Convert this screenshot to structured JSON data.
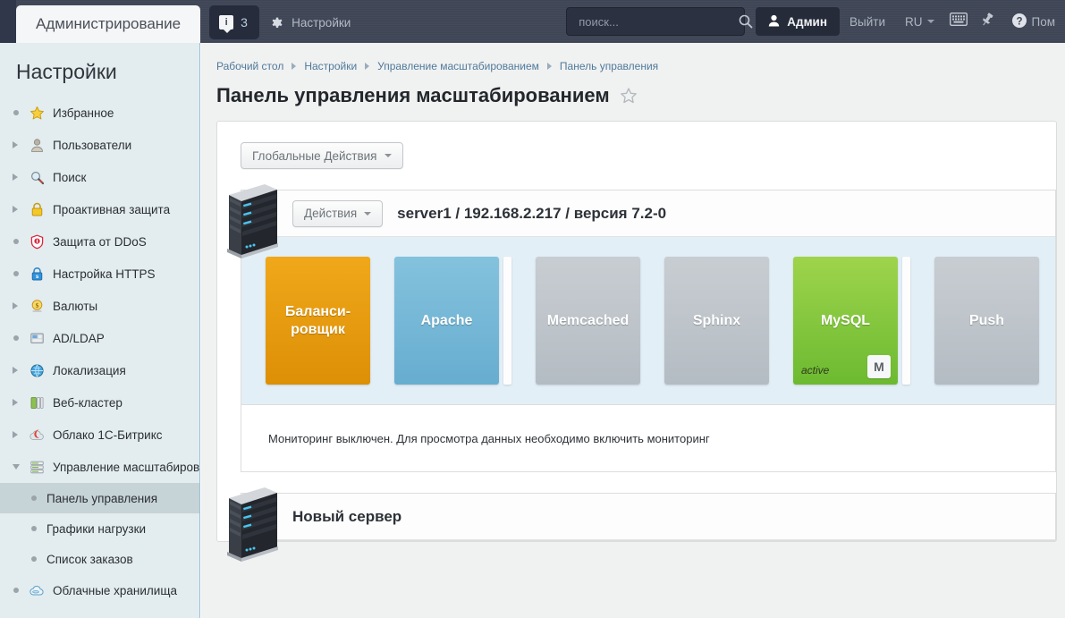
{
  "topbar": {
    "tab_label": "Администрирование",
    "info_icon": "info-icon",
    "info_count": "3",
    "gear_icon": "gear-icon",
    "settings_label": "Настройки",
    "search_placeholder": "поиск...",
    "search_value": "",
    "search_icon": "search-icon",
    "user_icon": "user-icon",
    "user_label": "Админ",
    "logout_label": "Выйти",
    "language_label": "RU",
    "keyboard_icon": "keyboard-icon",
    "pin_icon": "pin-icon",
    "help_icon": "help-icon",
    "help_label": "Пом"
  },
  "sidebar": {
    "title": "Настройки",
    "items": [
      {
        "label": "Избранное",
        "marker": "dot",
        "icon": "star-icon",
        "child": false,
        "selected": false
      },
      {
        "label": "Пользователи",
        "marker": "right",
        "icon": "user-icon",
        "child": false,
        "selected": false
      },
      {
        "label": "Поиск",
        "marker": "right",
        "icon": "magnifier-icon",
        "child": false,
        "selected": false
      },
      {
        "label": "Проактивная защита",
        "marker": "right",
        "icon": "lock-icon",
        "child": false,
        "selected": false
      },
      {
        "label": "Защита от DDoS",
        "marker": "dot",
        "icon": "shield-icon",
        "child": false,
        "selected": false
      },
      {
        "label": "Настройка HTTPS",
        "marker": "dot",
        "icon": "https-lock-icon",
        "child": false,
        "selected": false
      },
      {
        "label": "Валюты",
        "marker": "right",
        "icon": "currency-icon",
        "child": false,
        "selected": false
      },
      {
        "label": "AD/LDAP",
        "marker": "dot",
        "icon": "ldap-icon",
        "child": false,
        "selected": false
      },
      {
        "label": "Локализация",
        "marker": "right",
        "icon": "globe-icon",
        "child": false,
        "selected": false
      },
      {
        "label": "Веб-кластер",
        "marker": "right",
        "icon": "cluster-icon",
        "child": false,
        "selected": false
      },
      {
        "label": "Облако 1С-Битрикс",
        "marker": "right",
        "icon": "cloud-bitrix-icon",
        "child": false,
        "selected": false
      },
      {
        "label": "Управление масштабирова",
        "marker": "down",
        "icon": "scaling-icon",
        "child": false,
        "selected": false
      },
      {
        "label": "Панель управления",
        "marker": "dot",
        "icon": "",
        "child": true,
        "selected": true
      },
      {
        "label": "Графики нагрузки",
        "marker": "dot",
        "icon": "",
        "child": true,
        "selected": false
      },
      {
        "label": "Список заказов",
        "marker": "dot",
        "icon": "",
        "child": true,
        "selected": false
      },
      {
        "label": "Облачные хранилища",
        "marker": "dot",
        "icon": "cloud-storage-icon",
        "child": false,
        "selected": false
      }
    ]
  },
  "content": {
    "breadcrumb": [
      "Рабочий стол",
      "Настройки",
      "Управление масштабированием",
      "Панель управления"
    ],
    "page_title": "Панель управления масштабированием",
    "favorite_icon": "star-outline-icon",
    "global_actions_label": "Глобальные Действия",
    "servers": [
      {
        "actions_label": "Действия",
        "name": "server1 / 192.168.2.217 / версия 7.2-0",
        "server_icon": "server-tower-icon",
        "services": [
          {
            "name": "Баланси-\nровщик",
            "color": "orange",
            "status": "",
            "badge": "",
            "sliver": false
          },
          {
            "name": "Apache",
            "color": "blue",
            "status": "",
            "badge": "",
            "sliver": true
          },
          {
            "name": "Memcached",
            "color": "gray",
            "status": "",
            "badge": "",
            "sliver": false
          },
          {
            "name": "Sphinx",
            "color": "gray",
            "status": "",
            "badge": "",
            "sliver": false
          },
          {
            "name": "MySQL",
            "color": "green",
            "status": "active",
            "badge": "M",
            "sliver": true
          },
          {
            "name": "Push",
            "color": "gray",
            "status": "",
            "badge": "",
            "sliver": false
          }
        ],
        "monitor_note": "Мониторинг выключен. Для просмотра данных необходимо включить мониторинг"
      },
      {
        "actions_label": "",
        "name": "Новый сервер",
        "server_icon": "server-tower-icon",
        "services": [],
        "monitor_note": ""
      }
    ]
  },
  "colors": {
    "topbar_bg": "#3f4656",
    "sidebar_bg": "#e3ecee",
    "service_area_bg": "#e3eff6",
    "accent_orange": "#e89a0d",
    "accent_blue": "#73b5d5",
    "accent_green": "#82c73e",
    "accent_gray": "#bfc6cc",
    "link_blue": "#4f7a9b"
  }
}
